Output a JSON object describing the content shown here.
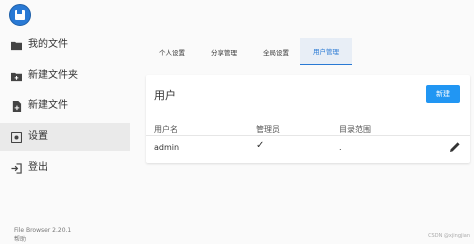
{
  "sidebar": {
    "items": [
      {
        "label": "我的文件",
        "icon": "folder-icon"
      },
      {
        "label": "新建文件夹",
        "icon": "new-folder-icon"
      },
      {
        "label": "新建文件",
        "icon": "new-file-icon"
      },
      {
        "label": "设置",
        "icon": "settings-icon"
      },
      {
        "label": "登出",
        "icon": "logout-icon"
      }
    ],
    "version": "File Browser 2.20.1",
    "help": "帮助"
  },
  "tabs": [
    {
      "label": "个人设置"
    },
    {
      "label": "分享管理"
    },
    {
      "label": "全局设置"
    },
    {
      "label": "用户管理",
      "active": true
    }
  ],
  "users_card": {
    "title": "用户",
    "new_button": "新建",
    "columns": [
      "用户名",
      "管理员",
      "目录范围"
    ],
    "rows": [
      {
        "username": "admin",
        "admin_mark": "✓",
        "scope": "."
      }
    ]
  },
  "watermark": "CSDN @xjingjian",
  "colors": {
    "accent": "#2196f3",
    "tab_active": "#2979d4"
  }
}
